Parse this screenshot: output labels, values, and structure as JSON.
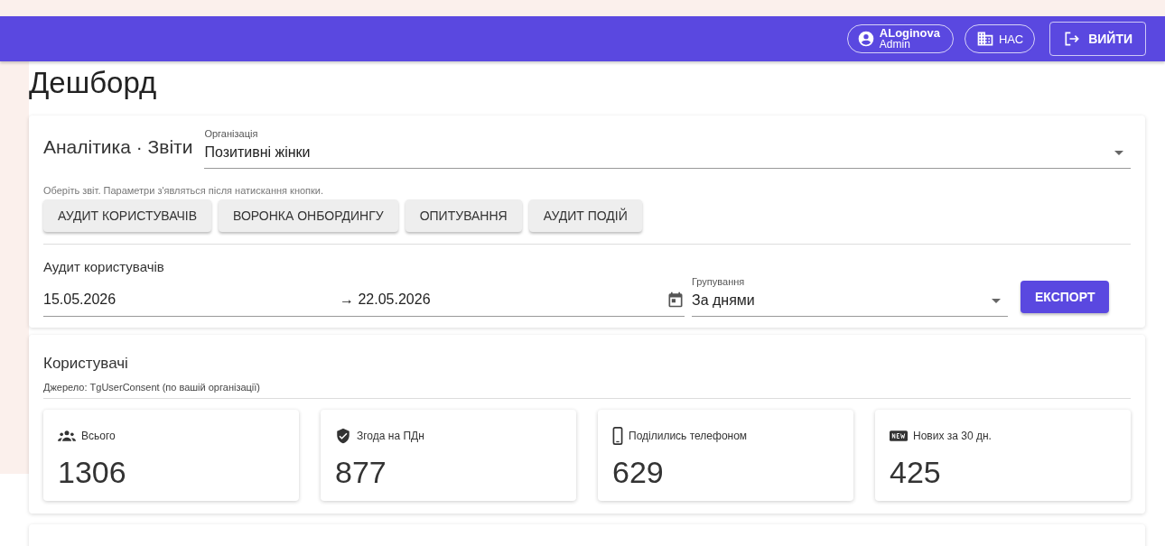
{
  "header": {
    "user": {
      "name": "ALoginova",
      "role": "Admin"
    },
    "org_button": "НАС",
    "logout_button": "ВИЙТИ"
  },
  "page_title": "Дешборд",
  "reports": {
    "title": "Аналітика · Звіти",
    "org_field": {
      "label": "Організація",
      "value": "Позитивні жінки"
    },
    "hint": "Оберіть звіт. Параметри з'являться після натискання кнопки.",
    "buttons": [
      {
        "label": "АУДИТ КОРИСТУВАЧІВ"
      },
      {
        "label": "ВОРОНКА ОНБОРДИНГУ"
      },
      {
        "label": "ОПИТУВАННЯ"
      },
      {
        "label": "АУДИТ ПОДІЙ"
      }
    ],
    "audit": {
      "title": "Аудит користувачів",
      "date_from": "15.05.2026",
      "arrow": "→",
      "date_to": "22.05.2026",
      "grouping": {
        "label": "Групування",
        "value": "За днями"
      },
      "export_button": "ЕКСПОРТ"
    }
  },
  "users": {
    "title": "Користувачі",
    "source": "Джерело: TgUserConsent (по вашій організації)",
    "stats": [
      {
        "kind": "people",
        "label": "Всього",
        "value": "1306"
      },
      {
        "kind": "shield",
        "label": "Згода на ПДн",
        "value": "877"
      },
      {
        "kind": "phone",
        "label": "Поділились телефоном",
        "value": "629"
      },
      {
        "kind": "new",
        "label": "Нових за 30 дн.",
        "value": "425"
      }
    ]
  }
}
